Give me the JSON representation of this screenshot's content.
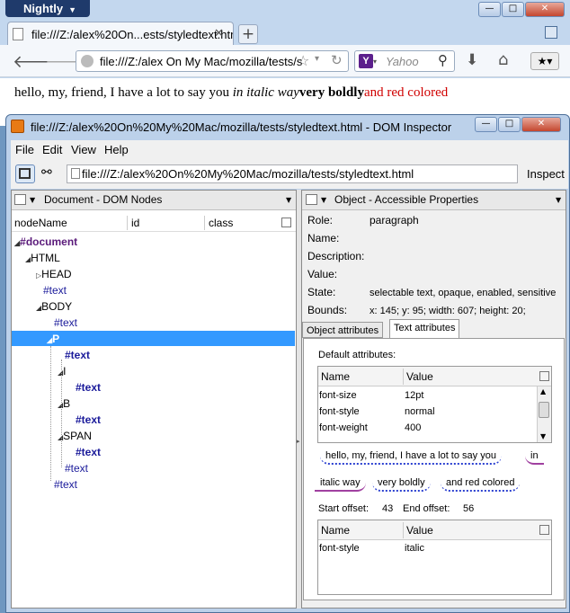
{
  "browser": {
    "app_button": "Nightly",
    "tab_title": "file:///Z:/alex%20On...ests/styledtext.html",
    "url": "file:///Z:/alex On My Mac/mozilla/tests/s",
    "search_placeholder": "Yahoo",
    "content": {
      "normal": "hello, my, friend, I have a lot to say you ",
      "italic": "in italic way",
      "bold": "very boldly",
      "red": "and red colored"
    }
  },
  "inspector": {
    "title": "file:///Z:/alex%20On%20My%20Mac/mozilla/tests/styledtext.html - DOM Inspector",
    "menu": [
      "File",
      "Edit",
      "View",
      "Help"
    ],
    "url": "file:///Z:/alex%20On%20My%20Mac/mozilla/tests/styledtext.html",
    "inspect_label": "Inspect",
    "left_panel": {
      "title": "Document - DOM Nodes",
      "columns": [
        "nodeName",
        "id",
        "class"
      ],
      "nodes": [
        "#document",
        "HTML",
        "HEAD",
        "#text",
        "BODY",
        "#text",
        "P",
        "#text",
        "I",
        "#text",
        "B",
        "#text",
        "SPAN",
        "#text",
        "#text",
        "#text"
      ]
    },
    "right_panel": {
      "title": "Object - Accessible Properties",
      "props": [
        {
          "label": "Role:",
          "value": "paragraph"
        },
        {
          "label": "Name:",
          "value": ""
        },
        {
          "label": "Description:",
          "value": ""
        },
        {
          "label": "Value:",
          "value": ""
        },
        {
          "label": "State:",
          "value": "selectable text, opaque, enabled, sensitive"
        },
        {
          "label": "Bounds:",
          "value": "x: 145;  y: 95;  width: 607;  height: 20;"
        }
      ],
      "tabs": [
        "Object attributes",
        "Text attributes"
      ],
      "default_attrs_label": "Default attributes:",
      "table_columns": [
        "Name",
        "Value"
      ],
      "default_attrs": [
        {
          "name": "font-size",
          "value": "12pt"
        },
        {
          "name": "font-style",
          "value": "normal"
        },
        {
          "name": "font-weight",
          "value": "400"
        }
      ],
      "segments": [
        "hello, my, friend, I have a lot to say you",
        "in",
        "italic way",
        "very boldly",
        "and red colored"
      ],
      "start_offset_label": "Start offset:",
      "start_offset": "43",
      "end_offset_label": "End offset:",
      "end_offset": "56",
      "attrs": [
        {
          "name": "font-style",
          "value": "italic"
        }
      ]
    }
  },
  "colors": {
    "accent": "#3399ff",
    "tag": "#5a1a7a",
    "text_node": "#1a1a9a",
    "red_text": "#d00000"
  }
}
